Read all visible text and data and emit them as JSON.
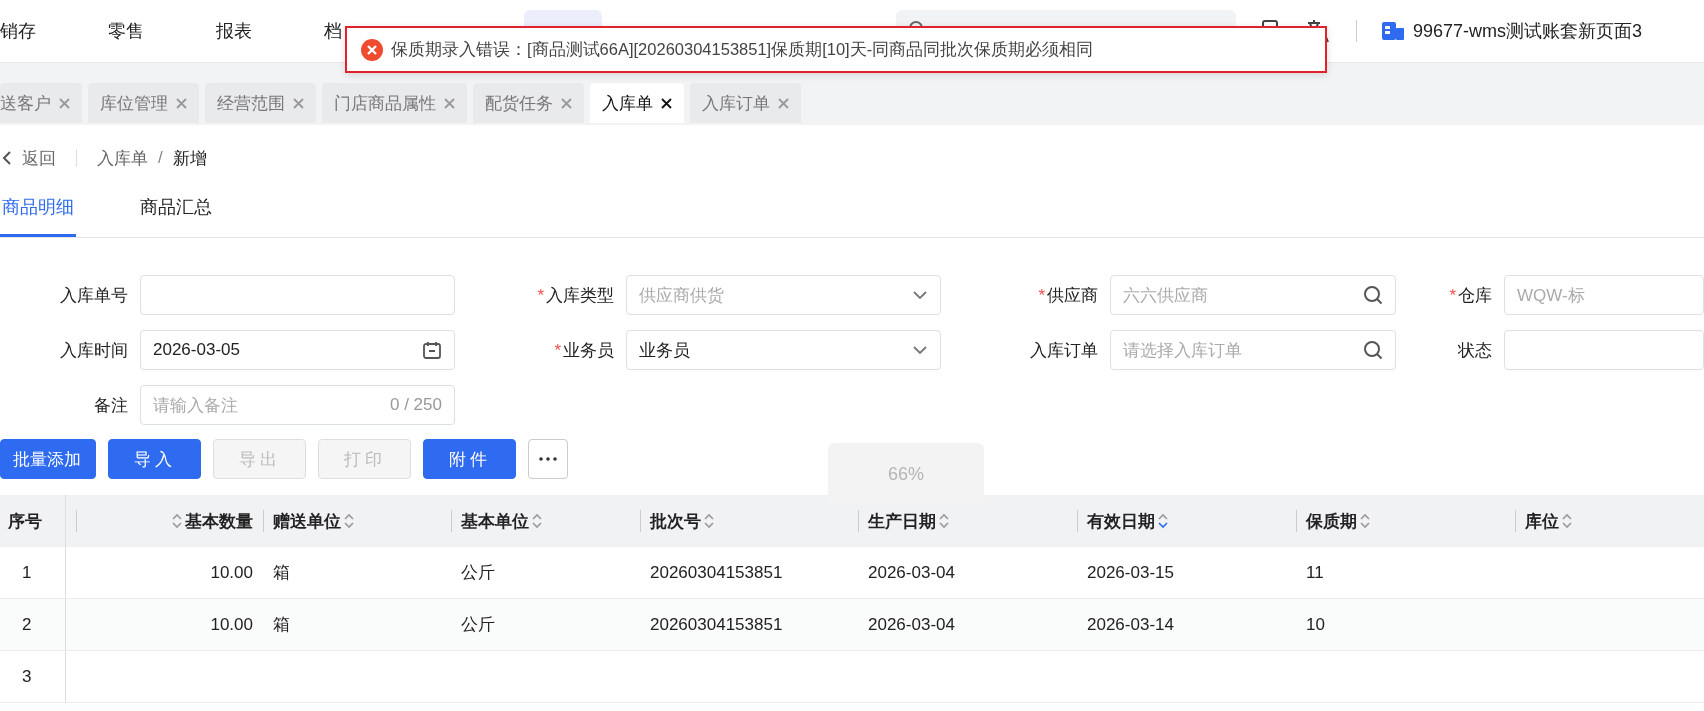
{
  "top_nav": {
    "items": [
      {
        "label": "销存",
        "selected": false
      },
      {
        "label": "零售",
        "selected": false
      },
      {
        "label": "报表",
        "selected": false
      },
      {
        "label": "档",
        "selected": false
      }
    ],
    "account": "99677-wms测试账套新页面3"
  },
  "toast": {
    "kind": "error",
    "message": "保质期录入错误：[商品测试66A][20260304153851]保质期[10]天-同商品同批次保质期必须相同"
  },
  "tabs": [
    {
      "label": "送客户",
      "selected": false
    },
    {
      "label": "库位管理",
      "selected": false
    },
    {
      "label": "经营范围",
      "selected": false
    },
    {
      "label": "门店商品属性",
      "selected": false
    },
    {
      "label": "配货任务",
      "selected": false
    },
    {
      "label": "入库单",
      "selected": true
    },
    {
      "label": "入库订单",
      "selected": false
    }
  ],
  "breadcrumb": {
    "back": "返回",
    "path": [
      "入库单",
      "新增"
    ],
    "separator": "/"
  },
  "sub_tabs": [
    {
      "label": "商品明细",
      "selected": true
    },
    {
      "label": "商品汇总",
      "selected": false
    }
  ],
  "form": {
    "required_mark": "*",
    "fields": [
      {
        "label": "入库单号",
        "required": false,
        "kind": "text"
      },
      {
        "label": "入库类型",
        "required": true,
        "kind": "select",
        "placeholder": "供应商供货"
      },
      {
        "label": "供应商",
        "required": true,
        "kind": "search",
        "placeholder": "六六供应商"
      },
      {
        "label": "仓库",
        "required": true,
        "kind": "text",
        "placeholder": "WQW-标"
      },
      {
        "label": "入库时间",
        "required": false,
        "kind": "date",
        "value": "2026-03-05"
      },
      {
        "label": "业务员",
        "required": true,
        "kind": "select",
        "value": "业务员"
      },
      {
        "label": "入库订单",
        "required": false,
        "kind": "search",
        "placeholder": "请选择入库订单"
      },
      {
        "label": "状态",
        "required": false,
        "kind": "text"
      },
      {
        "label": "备注",
        "required": false,
        "kind": "textarea",
        "placeholder": "请输入备注",
        "counter": "0 / 250"
      }
    ]
  },
  "toolbar": [
    {
      "kind": "primary",
      "label": "批量添加",
      "disabled": false
    },
    {
      "kind": "primary",
      "label": "导入",
      "disabled": false
    },
    {
      "kind": "primary",
      "label": "导出",
      "disabled": true
    },
    {
      "kind": "primary",
      "label": "打印",
      "disabled": true
    },
    {
      "kind": "primary",
      "label": "附件",
      "disabled": false
    },
    {
      "kind": "more"
    }
  ],
  "zoom_hint": "66%",
  "table": {
    "columns": [
      {
        "label": "序号",
        "sortable": false,
        "sorted": false
      },
      {
        "label": "基本数量",
        "sortable": true,
        "sorted": false,
        "kind": "number"
      },
      {
        "label": "赠送单位",
        "sortable": true,
        "sorted": false
      },
      {
        "label": "基本单位",
        "sortable": true,
        "sorted": false
      },
      {
        "label": "批次号",
        "sortable": true,
        "sorted": false
      },
      {
        "label": "生产日期",
        "sortable": true,
        "sorted": false
      },
      {
        "label": "有效日期",
        "sortable": true,
        "sorted": true
      },
      {
        "label": "保质期",
        "sortable": true,
        "sorted": false
      },
      {
        "label": "库位",
        "sortable": true,
        "sorted": false
      }
    ],
    "rows": [
      {
        "cells": [
          "1",
          "10.00",
          "箱",
          "公斤",
          "20260304153851",
          "2026-03-04",
          "2026-03-15",
          "11"
        ]
      },
      {
        "cells": [
          "2",
          "10.00",
          "箱",
          "公斤",
          "20260304153851",
          "2026-03-04",
          "2026-03-14",
          "10"
        ]
      },
      {
        "cells": [
          "3"
        ]
      }
    ]
  }
}
